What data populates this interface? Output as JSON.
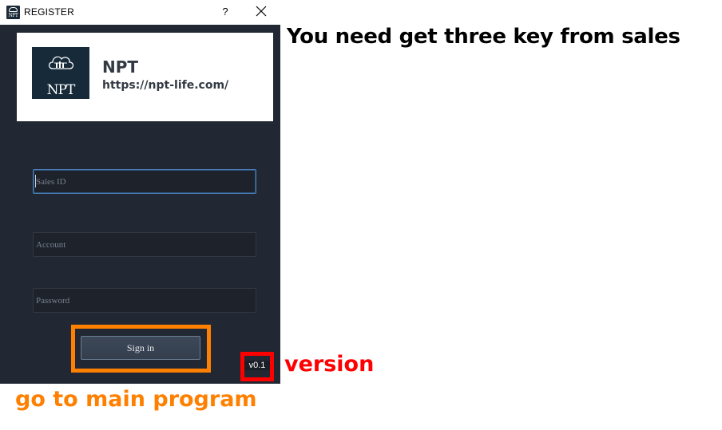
{
  "window": {
    "title": "REGISTER",
    "help_label": "?",
    "background_color": "#222833"
  },
  "logo": {
    "mark_text": "NPT",
    "brand_name": "NPT",
    "url": "https://npt-life.com/",
    "mark_bg_color": "#162a3a"
  },
  "form": {
    "sales_id_placeholder": "Sales ID",
    "account_placeholder": "Account",
    "password_placeholder": "Password",
    "signin_label": "Sign in",
    "focused_field": "sales_id"
  },
  "version": {
    "label": "v0.1"
  },
  "annotations": {
    "top_note": "You need get three key from sales",
    "version_note": "version",
    "signin_note": "go to main program",
    "signin_highlight_color": "#ff8000",
    "version_highlight_color": "#ff0000"
  }
}
